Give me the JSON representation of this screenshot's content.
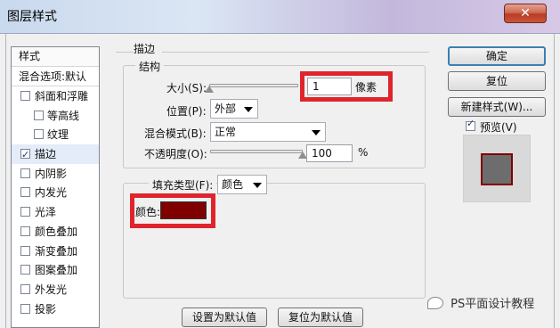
{
  "window": {
    "title": "图层样式",
    "close_glyph": "✕"
  },
  "style_list": {
    "header": "样式",
    "blend_options": "混合选项:默认",
    "items": [
      {
        "label": "斜面和浮雕",
        "checked": false,
        "sub": false
      },
      {
        "label": "等高线",
        "checked": false,
        "sub": true
      },
      {
        "label": "纹理",
        "checked": false,
        "sub": true
      },
      {
        "label": "描边",
        "checked": true,
        "sub": false,
        "selected": true
      },
      {
        "label": "内阴影",
        "checked": false,
        "sub": false
      },
      {
        "label": "内发光",
        "checked": false,
        "sub": false
      },
      {
        "label": "光泽",
        "checked": false,
        "sub": false
      },
      {
        "label": "颜色叠加",
        "checked": false,
        "sub": false
      },
      {
        "label": "渐变叠加",
        "checked": false,
        "sub": false
      },
      {
        "label": "图案叠加",
        "checked": false,
        "sub": false
      },
      {
        "label": "外发光",
        "checked": false,
        "sub": false
      },
      {
        "label": "投影",
        "checked": false,
        "sub": false
      }
    ]
  },
  "stroke": {
    "section_title": "描边",
    "structure_title": "结构",
    "size_label": "大小(S):",
    "size_value": "1",
    "size_unit": "像素",
    "size_slider_fraction": 0.0,
    "position_label": "位置(P):",
    "position_value": "外部",
    "blend_mode_label": "混合模式(B):",
    "blend_mode_value": "正常",
    "opacity_label": "不透明度(O):",
    "opacity_value": "100",
    "opacity_unit": "%",
    "opacity_slider_fraction": 1.0,
    "fill_type_label": "填充类型(F):",
    "fill_type_value": "颜色",
    "color_label": "颜色:",
    "color_hex": "#800000"
  },
  "buttons": {
    "ok": "确定",
    "reset": "复位",
    "new_style": "新建样式(W)...",
    "preview_label": "预览(V)",
    "preview_checked": true,
    "set_default": "设置为默认值",
    "reset_default": "复位为默认值"
  },
  "watermark": {
    "text": "PS平面设计教程"
  },
  "colors": {
    "highlight_frame": "#e0242c",
    "stroke_color": "#800000",
    "preview_fill": "#6d6d6d"
  }
}
